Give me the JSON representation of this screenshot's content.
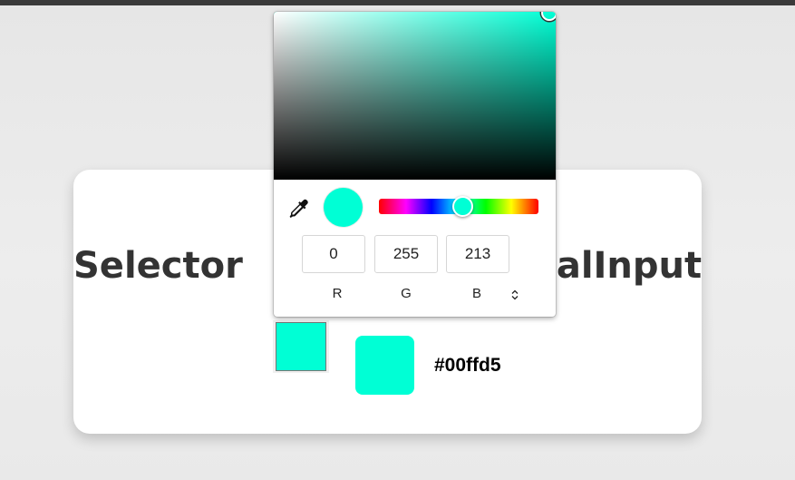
{
  "page": {
    "title": "Selector HTML5 ColorInput",
    "title_left": "Selector",
    "title_right": "alInput"
  },
  "current_color": {
    "hex_label": "#00ffd5",
    "value": "#00ffd5"
  },
  "picker": {
    "hue_color": "#00ffd5",
    "hue_degrees": 170,
    "saturation": 1.0,
    "brightness": 1.0,
    "rgb": {
      "r": "0",
      "g": "255",
      "b": "213"
    },
    "labels": {
      "r": "R",
      "g": "G",
      "b": "B"
    },
    "icons": {
      "eyedropper": "eyedropper-icon",
      "mode_toggle": "up-down-arrows-icon"
    }
  },
  "colors": {
    "selected": "#00ffd5",
    "card_background": "#ffffff",
    "title_text": "#333333"
  }
}
